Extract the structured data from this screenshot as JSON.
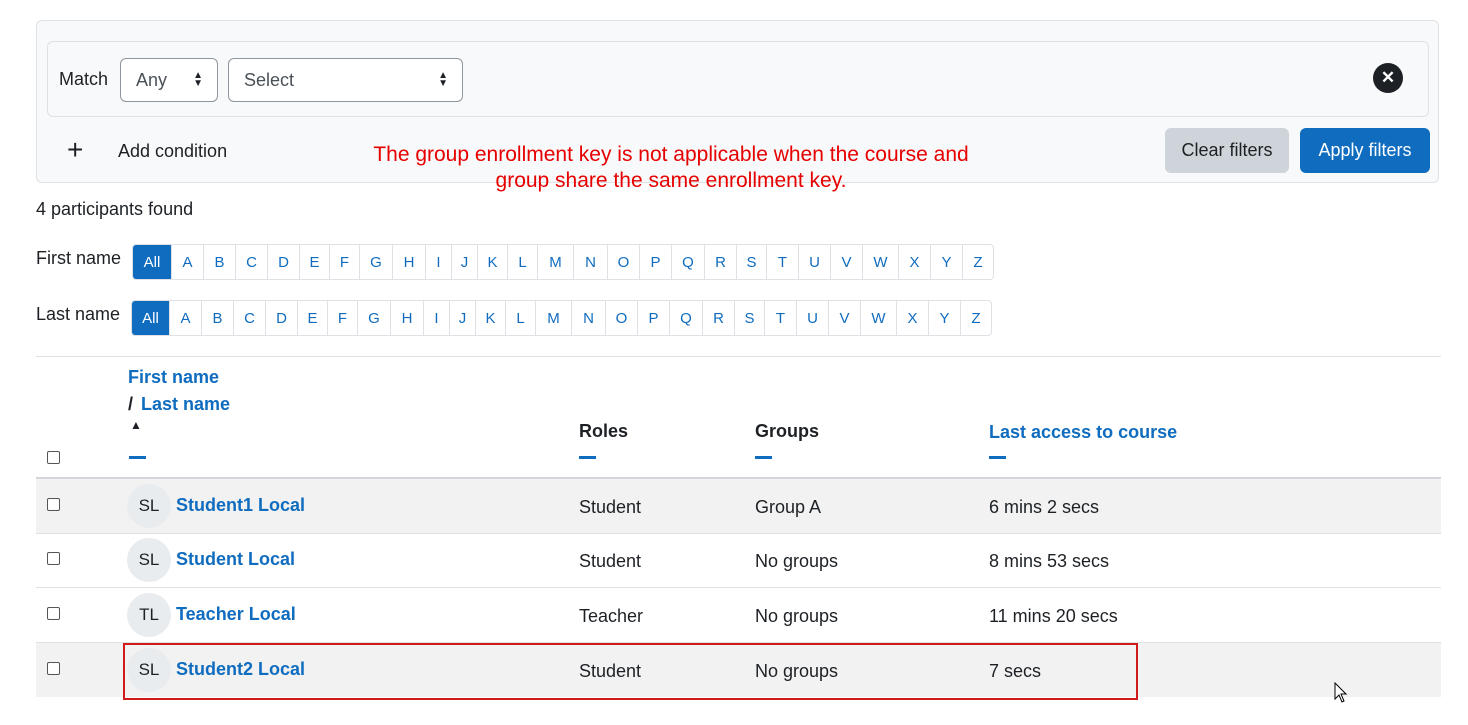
{
  "filter": {
    "match_label": "Match",
    "match_value": "Any",
    "select_value": "Select",
    "add_condition_label": "Add condition",
    "clear_label": "Clear filters",
    "apply_label": "Apply filters"
  },
  "annotation": {
    "line1": "The group enrollment key is not applicable when the course and",
    "line2": "group share the same enrollment key."
  },
  "participants_found": "4 participants found",
  "initials": {
    "first_label": "First name",
    "last_label": "Last name",
    "all_label": "All",
    "letters": [
      "A",
      "B",
      "C",
      "D",
      "E",
      "F",
      "G",
      "H",
      "I",
      "J",
      "K",
      "L",
      "M",
      "N",
      "O",
      "P",
      "Q",
      "R",
      "S",
      "T",
      "U",
      "V",
      "W",
      "X",
      "Y",
      "Z"
    ]
  },
  "table": {
    "headers": {
      "first_name": "First name",
      "slash": "/",
      "last_name": "Last name",
      "roles": "Roles",
      "groups": "Groups",
      "last_access": "Last access to course"
    },
    "rows": [
      {
        "initials": "SL",
        "name": "Student1 Local",
        "role": "Student",
        "groups": "Group A",
        "last_access": "6 mins 2 secs"
      },
      {
        "initials": "SL",
        "name": "Student Local",
        "role": "Student",
        "groups": "No groups",
        "last_access": "8 mins 53 secs"
      },
      {
        "initials": "TL",
        "name": "Teacher Local",
        "role": "Teacher",
        "groups": "No groups",
        "last_access": "11 mins 20 secs"
      },
      {
        "initials": "SL",
        "name": "Student2 Local",
        "role": "Student",
        "groups": "No groups",
        "last_access": "7 secs"
      }
    ]
  },
  "colors": {
    "accent": "#0f6cbf",
    "annotation": "#e60000",
    "highlight_border": "#d11a1a"
  }
}
